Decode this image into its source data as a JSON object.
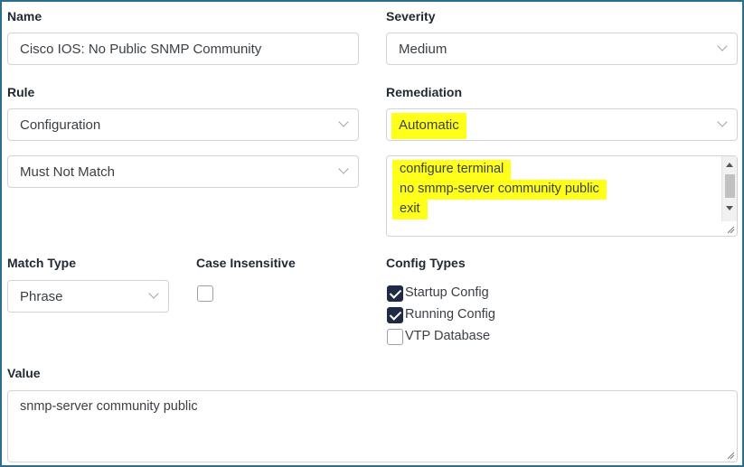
{
  "name": {
    "label": "Name",
    "value": "Cisco IOS: No Public SNMP Community"
  },
  "severity": {
    "label": "Severity",
    "value": "Medium"
  },
  "rule": {
    "label": "Rule",
    "type_value": "Configuration",
    "match_value": "Must Not Match"
  },
  "remediation": {
    "label": "Remediation",
    "mode_value": "Automatic",
    "commands": [
      "configure terminal",
      "no smmp-server community public",
      "exit"
    ]
  },
  "match_type": {
    "label": "Match Type",
    "value": "Phrase"
  },
  "case_insensitive": {
    "label": "Case Insensitive",
    "checked": false
  },
  "config_types": {
    "label": "Config Types",
    "options": [
      {
        "label": "Startup Config",
        "checked": true
      },
      {
        "label": "Running Config",
        "checked": true
      },
      {
        "label": "VTP Database",
        "checked": false
      }
    ]
  },
  "value_field": {
    "label": "Value",
    "value": "snmp-server community public"
  },
  "colors": {
    "highlight": "#ffff1a",
    "border_accent": "#2c6e8f",
    "checkbox_checked": "#1f2a44"
  }
}
